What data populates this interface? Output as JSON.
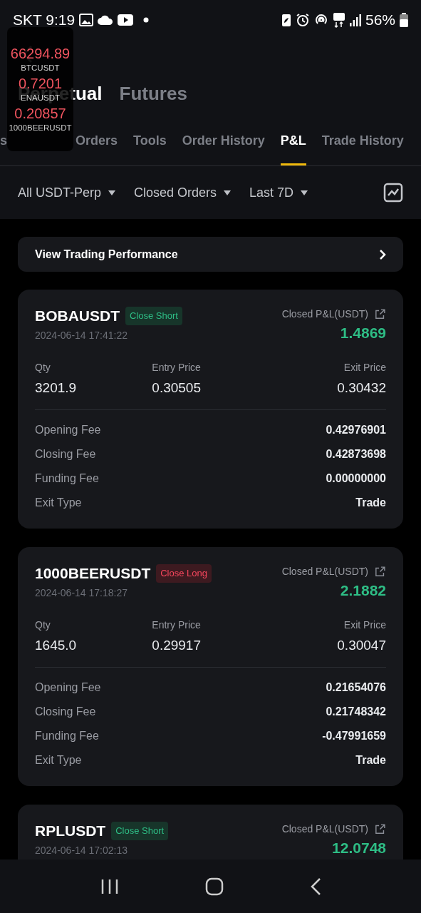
{
  "status_bar": {
    "carrier": "SKT",
    "time": "9:19",
    "battery": "56%"
  },
  "ticker_overlay": [
    {
      "price": "66294.89",
      "symbol": "BTCUSDT"
    },
    {
      "price": "0.7201",
      "symbol": "ENAUSDT"
    },
    {
      "price": "0.20857",
      "symbol": "1000BEERUSDT"
    }
  ],
  "header": {
    "tabs": [
      {
        "label": "Perpetual",
        "selected": true
      },
      {
        "label": "Futures",
        "selected": false
      }
    ]
  },
  "tabs": [
    {
      "label": "s",
      "selected": false
    },
    {
      "label": "Orders",
      "selected": false
    },
    {
      "label": "Tools",
      "selected": false
    },
    {
      "label": "Order History",
      "selected": false
    },
    {
      "label": "P&L",
      "selected": true
    },
    {
      "label": "Trade History",
      "selected": false
    }
  ],
  "filters": [
    {
      "label": "All USDT-Perp"
    },
    {
      "label": "Closed Orders"
    },
    {
      "label": "Last 7D"
    }
  ],
  "performance_button": {
    "label": "View Trading Performance"
  },
  "trades": [
    {
      "symbol": "BOBAUSDT",
      "tag": "Close Short",
      "kind": "short",
      "time": "2024-06-14 17:41:22",
      "pnl_label": "Closed P&L(USDT)",
      "pnl": "1.4869",
      "stats": [
        {
          "label": "Qty",
          "value": "3201.9"
        },
        {
          "label": "Entry Price",
          "value": "0.30505"
        },
        {
          "label": "Exit Price",
          "value": "0.30432"
        }
      ],
      "fees": [
        {
          "label": "Opening Fee",
          "value": "0.42976901"
        },
        {
          "label": "Closing Fee",
          "value": "0.42873698"
        },
        {
          "label": "Funding Fee",
          "value": "0.00000000"
        },
        {
          "label": "Exit Type",
          "value": "Trade"
        }
      ]
    },
    {
      "symbol": "1000BEERUSDT",
      "tag": "Close Long",
      "kind": "long",
      "time": "2024-06-14 17:18:27",
      "pnl_label": "Closed P&L(USDT)",
      "pnl": "2.1882",
      "stats": [
        {
          "label": "Qty",
          "value": "1645.0"
        },
        {
          "label": "Entry Price",
          "value": "0.29917"
        },
        {
          "label": "Exit Price",
          "value": "0.30047"
        }
      ],
      "fees": [
        {
          "label": "Opening Fee",
          "value": "0.21654076"
        },
        {
          "label": "Closing Fee",
          "value": "0.21748342"
        },
        {
          "label": "Funding Fee",
          "value": "-0.47991659"
        },
        {
          "label": "Exit Type",
          "value": "Trade"
        }
      ]
    },
    {
      "symbol": "RPLUSDT",
      "tag": "Close Short",
      "kind": "short",
      "time": "2024-06-14 17:02:13",
      "pnl_label": "Closed P&L(USDT)",
      "pnl": "12.0748"
    }
  ]
}
